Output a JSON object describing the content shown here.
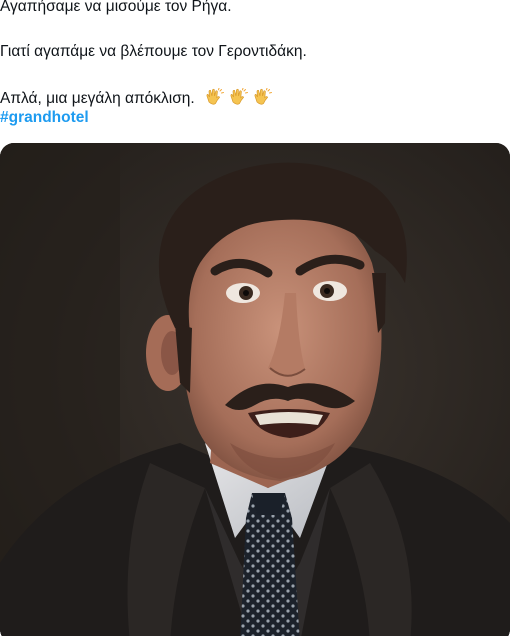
{
  "tweet": {
    "lines": [
      "Αγαπήσαμε να μισούμε τον Ρήγα.",
      "Γιατί αγαπάμε να βλέπουμε τον Γεροντιδάκη.",
      "Απλά, μια μεγάλη απόκλιση."
    ],
    "emoji": [
      "clapping-hands",
      "clapping-hands",
      "clapping-hands"
    ],
    "hashtag": "#grandhotel"
  },
  "media": {
    "type": "photo",
    "subject": "man with mustache, dark suit, white shirt, polka-dot tie, angry expression"
  },
  "colors": {
    "text": "#0f1419",
    "link": "#1d9bf0",
    "media_bg": "#2b2622"
  }
}
